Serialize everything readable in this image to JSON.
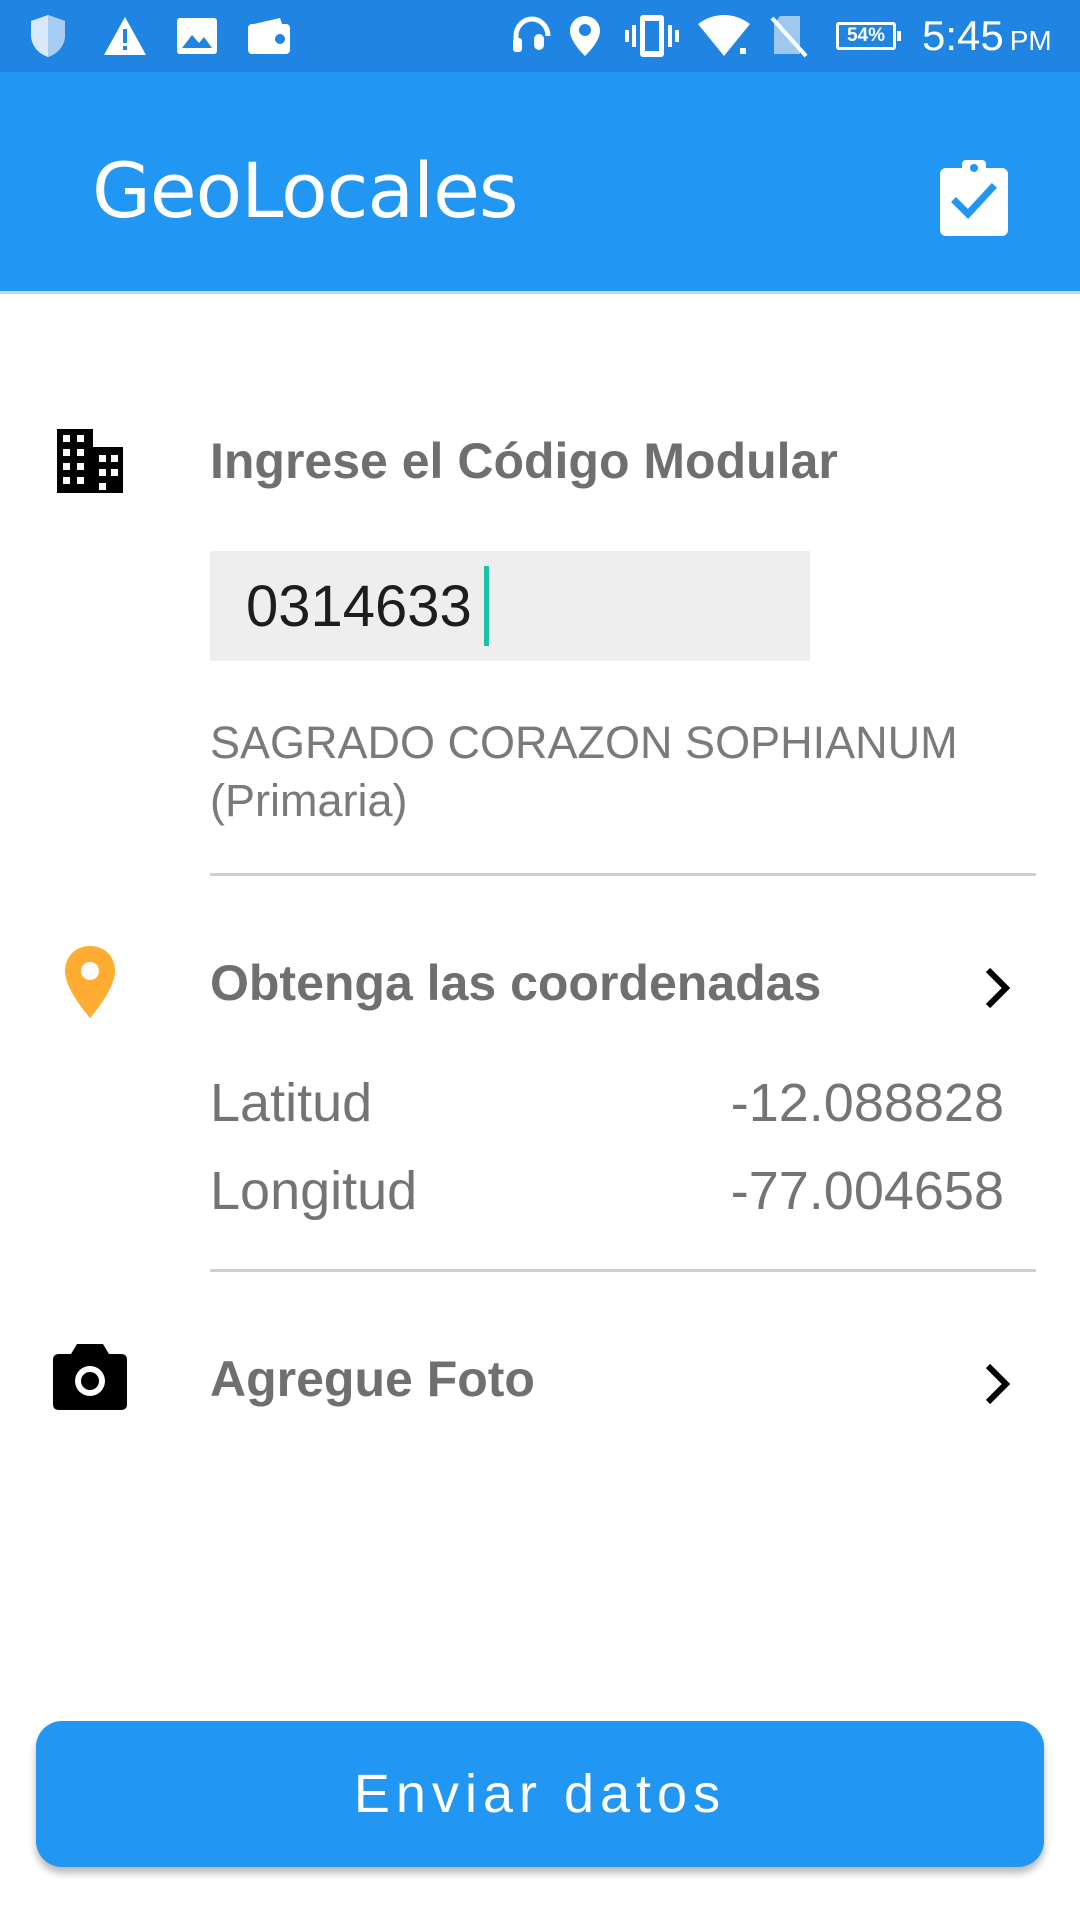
{
  "status_bar": {
    "icons": [
      "shield-icon",
      "warning-icon",
      "image-icon",
      "wallet-icon",
      "headset-mic-icon",
      "location-pin-icon",
      "vibrate-icon",
      "wifi-icon",
      "no-sim-icon"
    ],
    "battery": "54%",
    "time": "5:45",
    "ampm": "PM",
    "background_color": "#1f84e2"
  },
  "app_bar": {
    "title": "GeoLocales",
    "action_icon": "clipboard-check-icon",
    "background_color": "#2196f3"
  },
  "code_section": {
    "icon": "building-icon",
    "title": "Ingrese el Código Modular",
    "input_value": "0314633",
    "school_name": "SAGRADO CORAZON SOPHIANUM (Primaria)"
  },
  "coords_section": {
    "icon": "location-pin-icon",
    "icon_color": "#ffac33",
    "title": "Obtenga las coordenadas",
    "latitude_label": "Latitud",
    "latitude_value": "-12.088828",
    "longitude_label": "Longitud",
    "longitude_value": "-77.004658"
  },
  "photo_section": {
    "icon": "camera-icon",
    "title": "Agregue Foto"
  },
  "submit": {
    "label": "Enviar datos",
    "background_color": "#2196f3"
  }
}
